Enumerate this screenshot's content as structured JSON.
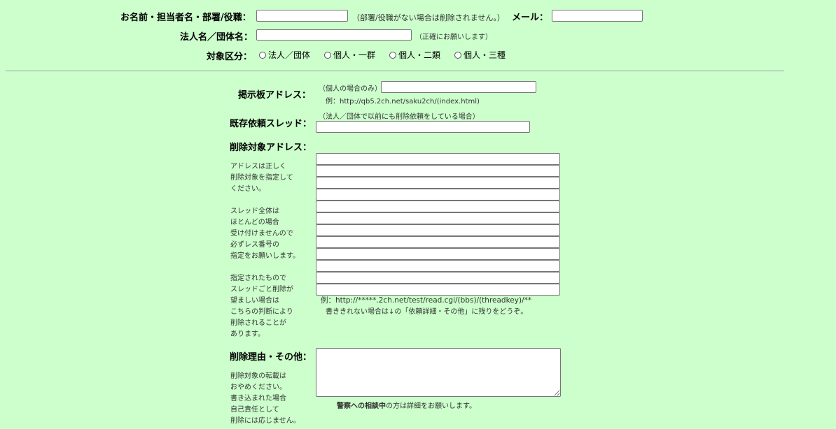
{
  "row1": {
    "name_label": "お名前・担当者名・部署/役職：",
    "name_note": "（部署/役職がない場合は削除されません。）",
    "mail_label": "メール：",
    "name_value": "",
    "mail_value": ""
  },
  "row2": {
    "corp_label": "法人名／団体名：",
    "corp_note": "（正確にお願いします）",
    "corp_value": ""
  },
  "row3": {
    "category_label": "対象区分：",
    "options": [
      "法人／団体",
      "個人・一群",
      "個人・二類",
      "個人・三種"
    ]
  },
  "board": {
    "label": "掲示板アドレス：",
    "note": "（個人の場合のみ）",
    "example": "例：http://qb5.2ch.net/saku2ch/(index.html)",
    "value": ""
  },
  "existing": {
    "label": "既存依頼スレッド：",
    "note": "（法人／団体で以前にも削除依頼をしている場合）",
    "value": ""
  },
  "target": {
    "label": "削除対象アドレス：",
    "side_lines": [
      "アドレスは正しく",
      "削除対象を指定して",
      "ください。",
      "",
      "スレッド全体は",
      "ほとんどの場合",
      "受け付けませんので",
      "必ずレス番号の",
      "指定をお願いします。",
      "",
      "指定されたもので",
      "スレッドごと削除が",
      "望ましい場合は",
      "こちらの判断により",
      "削除されることが",
      "あります。"
    ],
    "inputs": [
      "",
      "",
      "",
      "",
      "",
      "",
      "",
      "",
      "",
      "",
      "",
      ""
    ],
    "example": "例：http://*****.2ch.net/test/read.cgi/(bbs)/(threadkey)/**",
    "overflow_note": "書ききれない場合は↓の「依頼詳細・その他」に残りをどうぞ。"
  },
  "reason": {
    "label": "削除理由・その他：",
    "side_lines": [
      "削除対象の転載は",
      "おやめください。",
      "書き込まれた場合",
      "自己責任として",
      "削除には応じません。"
    ],
    "value": "",
    "police_bold": "警察への相談中",
    "police_rest": "の方は詳細をお願いします。"
  }
}
